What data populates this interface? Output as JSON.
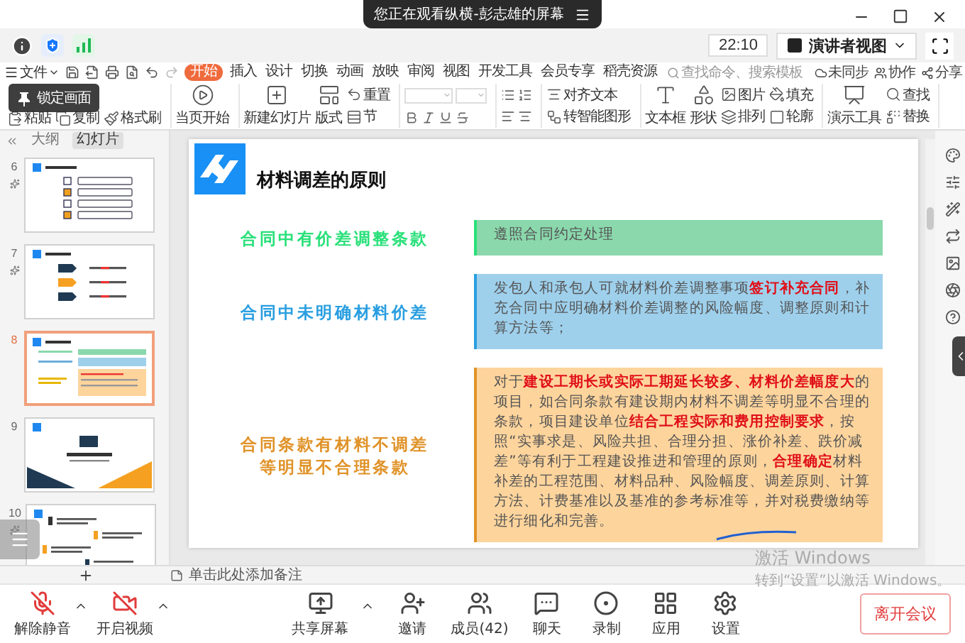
{
  "share_banner": {
    "text": "您正在观看纵横-彭志雄的屏幕"
  },
  "meeting_bar": {
    "time": "22:10",
    "view_button": "演讲者视图"
  },
  "ribbon": {
    "file_menu": "文件",
    "tabs": [
      {
        "label": "开始",
        "selected": true
      },
      {
        "label": "插入",
        "selected": false
      },
      {
        "label": "设计",
        "selected": false
      },
      {
        "label": "切换",
        "selected": false
      },
      {
        "label": "动画",
        "selected": false
      },
      {
        "label": "放映",
        "selected": false
      },
      {
        "label": "审阅",
        "selected": false
      },
      {
        "label": "视图",
        "selected": false
      },
      {
        "label": "开发工具",
        "selected": false
      },
      {
        "label": "会员专享",
        "selected": false
      },
      {
        "label": "稻壳资源",
        "selected": false
      }
    ],
    "search": {
      "placeholder": "查找命令、搜索模板"
    },
    "actions": [
      {
        "label": "未同步",
        "kind": "sync"
      },
      {
        "label": "协作",
        "kind": "collab"
      },
      {
        "label": "分享",
        "kind": "share"
      }
    ],
    "tool_groups": [
      {
        "tooltip": "锁定画面",
        "columns": [
          [
            {
              "label": "粘贴",
              "kind": "paste"
            }
          ],
          [
            {
              "label": "复制",
              "kind": "copy"
            }
          ],
          [
            {
              "label": "格式刷",
              "kind": "brush"
            }
          ]
        ]
      },
      {
        "columns": [
          [
            {
              "label": "当页开始",
              "kind": "play"
            }
          ]
        ]
      },
      {
        "columns": [
          [
            {
              "label": "新建幻灯片",
              "kind": "new_slide"
            }
          ],
          [
            {
              "label": "版式",
              "kind": "layout"
            }
          ],
          [
            {
              "label": "重置",
              "kind": "reset"
            },
            {
              "label": "节",
              "kind": "section"
            }
          ]
        ]
      },
      {
        "columns": [
          [
            {
              "label": "对齐文本",
              "kind": "align_text"
            },
            {
              "label": "转智能图形",
              "kind": "smart_art"
            }
          ]
        ]
      },
      {
        "columns": [
          [
            {
              "label": "文本框",
              "kind": "textbox"
            }
          ],
          [
            {
              "label": "形状",
              "kind": "shape"
            }
          ],
          [
            {
              "label": "图片",
              "kind": "picture"
            },
            {
              "label": "排列",
              "kind": "arrange"
            }
          ],
          [
            {
              "label": "填充",
              "kind": "fill"
            },
            {
              "label": "轮廓",
              "kind": "outline"
            }
          ]
        ]
      },
      {
        "columns": [
          [
            {
              "label": "演示工具",
              "kind": "present"
            }
          ],
          [
            {
              "label": "查找",
              "kind": "find"
            },
            {
              "label": "替换",
              "kind": "replace"
            }
          ]
        ]
      }
    ]
  },
  "panel": {
    "tabs": [
      {
        "label": "大纲",
        "selected": false
      },
      {
        "label": "幻灯片",
        "selected": true
      }
    ],
    "slides": [
      {
        "number": "6",
        "kind": "list",
        "selected": false
      },
      {
        "number": "7",
        "kind": "steps",
        "selected": false
      },
      {
        "number": "8",
        "kind": "table",
        "selected": true
      },
      {
        "number": "9",
        "kind": "section",
        "selected": false
      },
      {
        "number": "10",
        "kind": "numbered",
        "selected": false
      }
    ]
  },
  "slide": {
    "title": "材料调差的原则",
    "rows": [
      {
        "label": "合同中有价差调整条款",
        "text": "遵照合同约定处理",
        "color": "#8ad8ac"
      },
      {
        "label": "合同中未明确材料价差",
        "text": "发包人和承包人可就材料价差调整事项**签订补充合同**，补充合同中应明确材料价差调整的风险幅度、调整原则和计算方法等；",
        "color": "#9ed0ec"
      },
      {
        "label": "合同条款有材料不调差等明显不合理条款",
        "text": "对于**建设工期长或实际工期延长较多、材料价差幅度大**的项目，如合同条款有建设期内材料不调差等明显不合理的条款，项目建设单位**结合工程实际和费用控制要求**，按照“实事求是、风险共担、合理分担、涨价补差、跌价减差”等有利于工程建设推进和管理的原则，**合理确定**材料补差的工程范围、材料品种、风险幅度、调差原则、计算方法、计费基准以及基准的参考标准等，并对税费缴纳等进行细化和完善。",
        "color": "#fdd49c"
      }
    ]
  },
  "notes_placeholder": "单击此处添加备注",
  "windows_notice": {
    "title": "激活 Windows",
    "text": "转到“设置”以激活 Windows。"
  },
  "toolbar": {
    "left": [
      {
        "label": "解除静音",
        "kind": "mic_off"
      },
      {
        "label": "开启视频",
        "kind": "video_off"
      }
    ],
    "center": [
      {
        "label": "共享屏幕",
        "kind": "share_screen"
      },
      {
        "label": "邀请",
        "kind": "invite"
      },
      {
        "label": "成员(42)",
        "kind": "members"
      },
      {
        "label": "聊天",
        "kind": "chat"
      },
      {
        "label": "录制",
        "kind": "record"
      },
      {
        "label": "应用",
        "kind": "apps"
      },
      {
        "label": "设置",
        "kind": "settings"
      }
    ],
    "leave_button": "离开会议"
  }
}
